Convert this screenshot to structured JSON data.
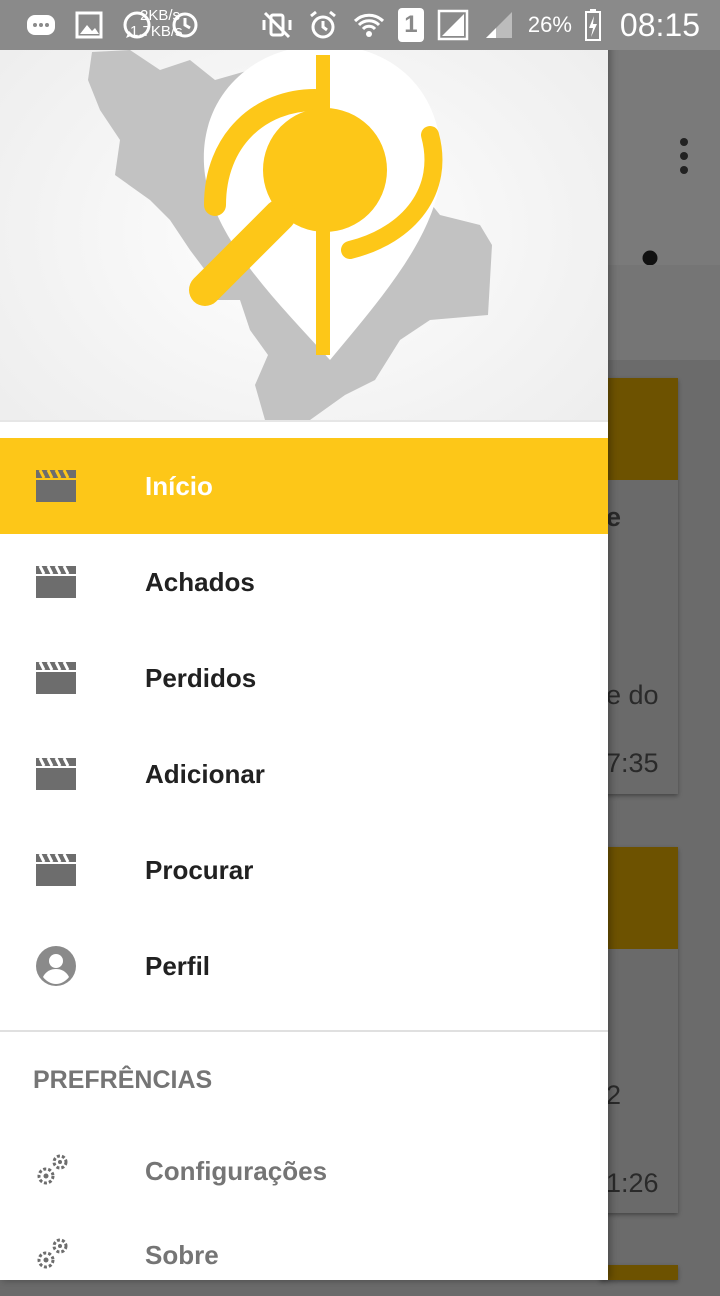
{
  "status_bar": {
    "speed_up": "2KB/s",
    "speed_down": "1.7KB/s",
    "battery_percent": "26%",
    "time": "08:15",
    "sim_slot": "1"
  },
  "drawer": {
    "menu_items": [
      {
        "label": "Início",
        "icon": "clapperboard-icon",
        "active": true
      },
      {
        "label": "Achados",
        "icon": "clapperboard-icon",
        "active": false
      },
      {
        "label": "Perdidos",
        "icon": "clapperboard-icon",
        "active": false
      },
      {
        "label": "Adicionar",
        "icon": "clapperboard-icon",
        "active": false
      },
      {
        "label": "Procurar",
        "icon": "clapperboard-icon",
        "active": false
      },
      {
        "label": "Perfil",
        "icon": "account-circle-icon",
        "active": false
      }
    ],
    "section_title": "PREFRÊNCIAS",
    "pref_items": [
      {
        "label": "Configurações",
        "icon": "gears-icon"
      },
      {
        "label": "Sobre",
        "icon": "gears-icon"
      }
    ]
  },
  "background": {
    "card1_text_a": "e",
    "card1_text_b": "e do",
    "card1_time": "7:35",
    "card2_text": "2",
    "card2_time": "1:26"
  },
  "colors": {
    "accent": "#fdc718",
    "status_bar": "#8a8a8a",
    "scrim": "#6b6b6b"
  }
}
